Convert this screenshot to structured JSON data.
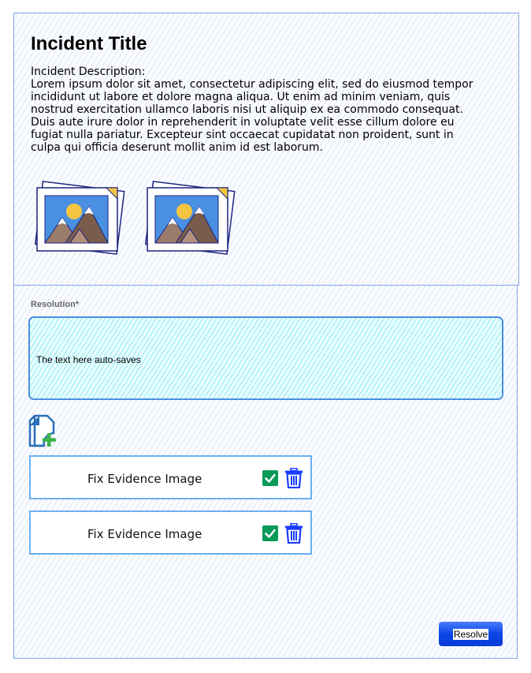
{
  "incident": {
    "title": "Incident Title",
    "description_label": "Incident Description:",
    "description": "Lorem ipsum dolor sit amet, consectetur adipiscing elit, sed do eiusmod tempor incididunt ut labore et dolore magna aliqua. Ut enim ad minim veniam, quis nostrud exercitation ullamco laboris nisi ut aliquip ex ea commodo consequat. Duis aute irure dolor in reprehenderit in voluptate velit esse cillum dolore eu fugiat nulla pariatur. Excepteur sint occaecat cupidatat non proident, sunt in culpa qui officia deserunt mollit anim id est laborum.",
    "images": [
      {
        "icon": "image-stack-icon"
      },
      {
        "icon": "image-stack-icon"
      }
    ]
  },
  "resolution": {
    "label": "Resolution*",
    "value": "The text here auto-saves"
  },
  "add_file": {
    "icon": "add-file-icon"
  },
  "evidence_items": [
    {
      "label": "Fix Evidence Image",
      "check_icon": "check-icon",
      "delete_icon": "trash-icon"
    },
    {
      "label": "Fix Evidence Image",
      "check_icon": "check-icon",
      "delete_icon": "trash-icon"
    }
  ],
  "actions": {
    "resolve_label": "Resolve"
  },
  "colors": {
    "frame_border": "#7ea6e0",
    "input_border": "#4a90e2",
    "input_fill": "#eafcff",
    "check_green": "#0a9a5a",
    "trash_blue": "#1a3dff",
    "add_green": "#3cb34a",
    "button_blue": "#0b45e5"
  }
}
